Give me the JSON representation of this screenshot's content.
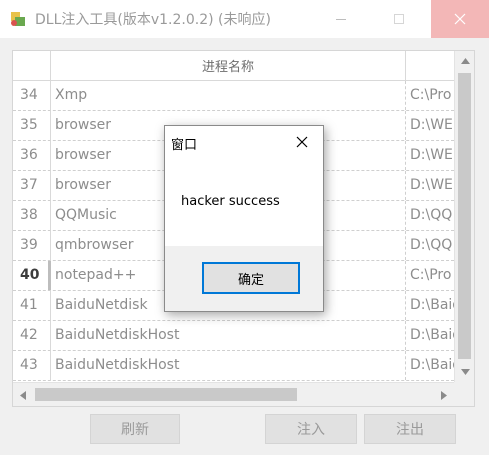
{
  "window": {
    "title": "DLL注入工具(版本v1.2.0.2) (未响应)",
    "colors": {
      "close_hover": "#f3b7b7",
      "focus_accent": "#0078d7"
    }
  },
  "titlebar": {
    "icons": [
      "app-icon",
      "minimize-icon",
      "maximize-icon",
      "close-icon"
    ]
  },
  "table": {
    "header": {
      "name": "进程名称"
    },
    "current_row": "40",
    "rows": [
      {
        "num": "34",
        "name": "Xmp",
        "path": "C:\\Pro"
      },
      {
        "num": "35",
        "name": "browser",
        "path": "D:\\WE"
      },
      {
        "num": "36",
        "name": "browser",
        "path": "D:\\WE"
      },
      {
        "num": "37",
        "name": "browser",
        "path": "D:\\WE"
      },
      {
        "num": "38",
        "name": "QQMusic",
        "path": "D:\\QQ"
      },
      {
        "num": "39",
        "name": "qmbrowser",
        "path": "D:\\QQ"
      },
      {
        "num": "40",
        "name": "notepad++",
        "path": "C:\\Pro"
      },
      {
        "num": "41",
        "name": "BaiduNetdisk",
        "path": "D:\\Baid"
      },
      {
        "num": "42",
        "name": "BaiduNetdiskHost",
        "path": "D:\\Baid"
      },
      {
        "num": "43",
        "name": "BaiduNetdiskHost",
        "path": "D:\\Baid"
      }
    ]
  },
  "buttons": {
    "refresh": "刷新",
    "inject": "注入",
    "eject": "注出"
  },
  "dialog": {
    "title": "窗口",
    "message": "hacker success",
    "ok_label": "确定"
  }
}
